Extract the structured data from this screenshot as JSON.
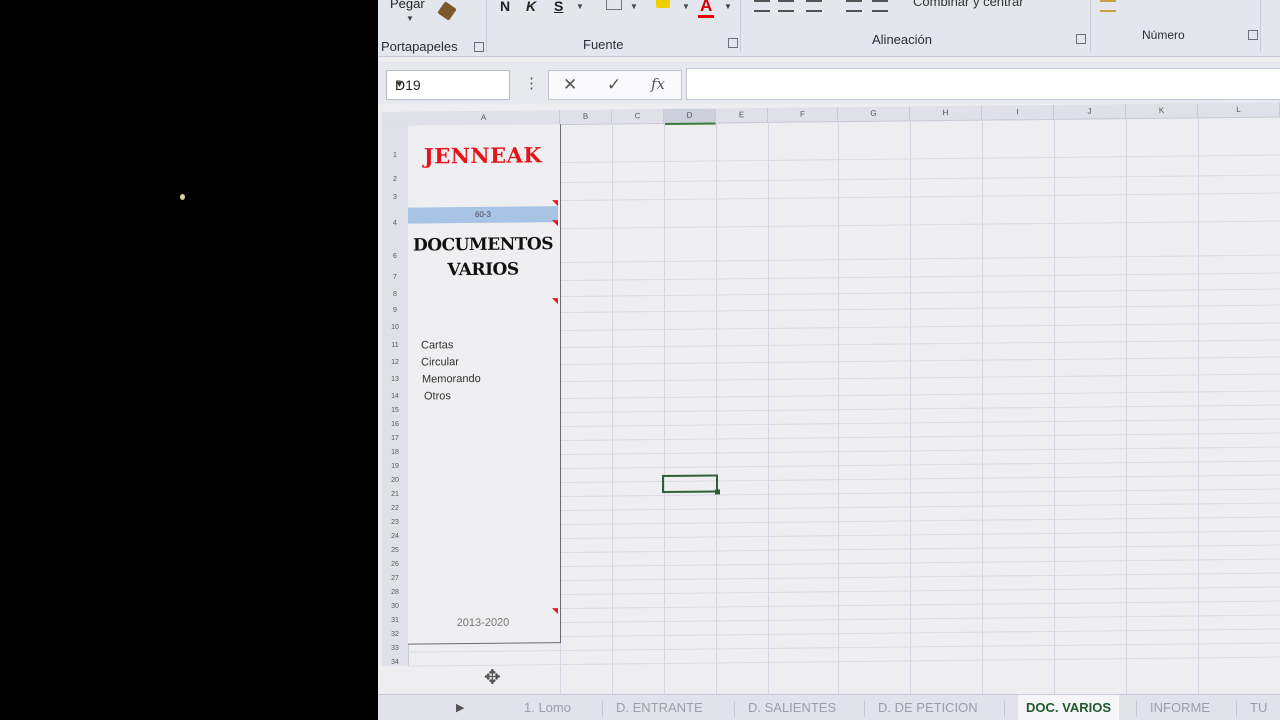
{
  "ribbon": {
    "paste_label": "Pegar",
    "bold_label": "N",
    "italic_label": "K",
    "underline_label": "S",
    "font_color_label": "A",
    "merge_label": "Combinar y centrar",
    "groups": {
      "clipboard": "Portapapeles",
      "font": "Fuente",
      "alignment": "Alineación",
      "number": "Número"
    },
    "accent_color": "#2b7a3b"
  },
  "formula_bar": {
    "name_box": "D19",
    "cancel_icon": "✕",
    "enter_icon": "✓",
    "fx_label": "fx",
    "formula": ""
  },
  "grid": {
    "columns": [
      "A",
      "B",
      "C",
      "D",
      "E",
      "F",
      "G",
      "H",
      "I",
      "J",
      "K",
      "L"
    ],
    "selected_column": "D",
    "selected_cell": "D19",
    "rows": [
      "1",
      "2",
      "3",
      "4",
      "6",
      "7",
      "8",
      "9",
      "10",
      "11",
      "12",
      "13",
      "14",
      "15",
      "16",
      "17",
      "18",
      "19",
      "20",
      "21",
      "22",
      "23",
      "24",
      "25",
      "26",
      "27",
      "28",
      "30",
      "31",
      "32",
      "33",
      "34"
    ]
  },
  "cover": {
    "brand": "JENNEAK",
    "code": "60-3",
    "title_line1": "DOCUMENTOS",
    "title_line2": "VARIOS",
    "items": [
      "Cartas",
      "Circular",
      "Memorando",
      "Otros"
    ],
    "years": "2013-2020",
    "brand_color": "#e2161a"
  },
  "sheet_tabs": [
    {
      "label": "1. Lomo",
      "active": false
    },
    {
      "label": "D. ENTRANTE",
      "active": false
    },
    {
      "label": "D. SALIENTES",
      "active": false
    },
    {
      "label": "D. DE PETICION",
      "active": false
    },
    {
      "label": "DOC. VARIOS",
      "active": true
    },
    {
      "label": "INFORME",
      "active": false
    },
    {
      "label": "TU",
      "active": false
    }
  ]
}
